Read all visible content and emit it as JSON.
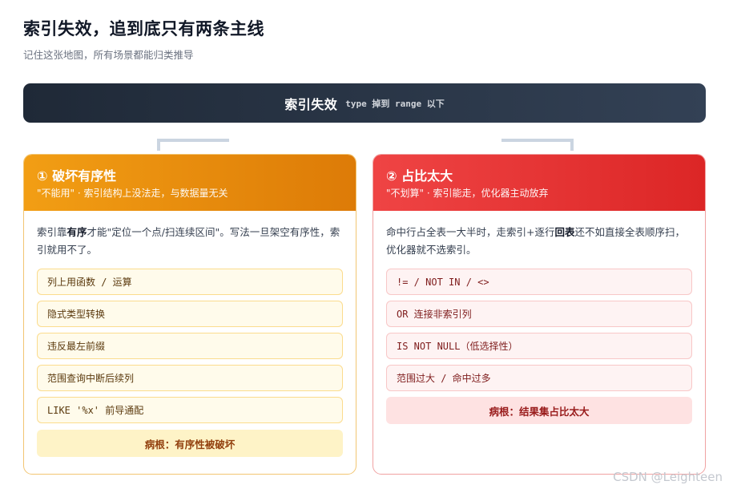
{
  "header": {
    "title": "索引失效，追到底只有两条主线",
    "subtitle": "记住这张地图，所有场景都能归类推导"
  },
  "topbar": {
    "main": "索引失效",
    "sub": "type 掉到 range 以下"
  },
  "left_card": {
    "title": "① 破坏有序性",
    "tag": "\"不能用\" · 索引结构上没法走，与数据量无关",
    "desc_pre": "索引靠",
    "desc_bold": "有序",
    "desc_post": "才能\"定位一个点/扫连续区间\"。写法一旦架空有序性，索引就用不了。",
    "items": [
      "列上用函数 / 运算",
      "隐式类型转换",
      "违反最左前缀",
      "范围查询中断后续列",
      "LIKE '%x' 前导通配"
    ],
    "root": "病根：有序性被破坏",
    "accent": "#e98b0c"
  },
  "right_card": {
    "title": "② 占比太大",
    "tag": "\"不划算\" · 索引能走，优化器主动放弃",
    "desc_pre": "命中行占全表一大半时，走索引+逐行",
    "desc_bold": "回表",
    "desc_post": "还不如直接全表顺序扫，优化器就不选索引。",
    "items": [
      "!= / NOT IN / <>",
      "OR 连接非索引列",
      "IS NOT NULL（低选择性）",
      "范围过大 / 命中过多"
    ],
    "root": "病根：结果集占比太大",
    "accent": "#e53232"
  },
  "watermark": "CSDN @Leighteen"
}
